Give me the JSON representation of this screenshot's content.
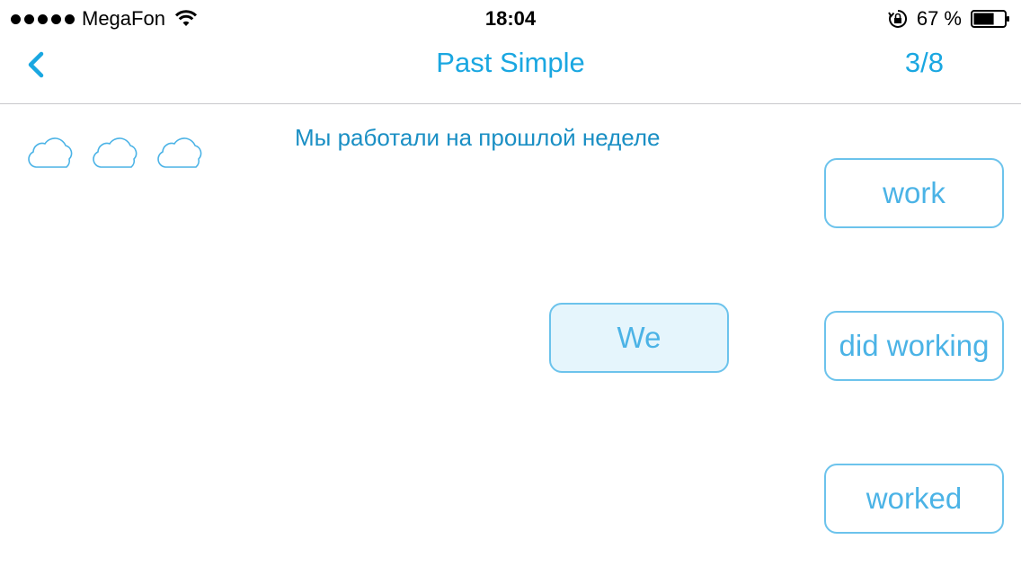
{
  "status_bar": {
    "carrier": "MegaFon",
    "time": "18:04",
    "battery_percent": "67 %",
    "battery_level": 0.67,
    "icons": [
      "signal-dots",
      "wifi-icon",
      "orientation-lock-icon",
      "battery-icon"
    ]
  },
  "nav": {
    "back_icon": "chevron-left-icon",
    "title": "Past Simple",
    "progress": "3/8"
  },
  "lives": {
    "count": 3,
    "icon": "cloud-icon"
  },
  "exercise": {
    "prompt": "Мы работали на прошлой неделе",
    "answer_words": [
      "We"
    ],
    "options": [
      "work",
      "did working",
      "worked"
    ]
  },
  "colors": {
    "accent": "#1aa7e1",
    "chip_border": "#6cc3ec",
    "chip_text": "#4bb3e6",
    "chip_selected_bg": "#e5f5fc",
    "prompt_text": "#1a8fc4"
  }
}
